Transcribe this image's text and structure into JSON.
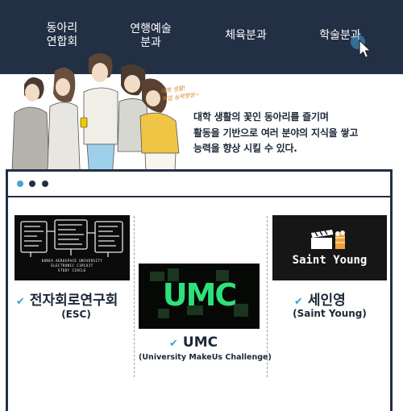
{
  "nav": {
    "items": [
      {
        "line1": "동아리",
        "line2": "연합회"
      },
      {
        "line1": "연행예술",
        "line2": "분과"
      },
      {
        "line1": "체육분과",
        "line2": ""
      },
      {
        "line1": "학술분과",
        "line2": ""
      }
    ]
  },
  "hero": {
    "handwriting_line1": "대학 생활!",
    "handwriting_line2": "학업 능력향상~",
    "text_lines": [
      "대학 생활의 꽃인 동아리를 즐기며",
      "활동을 기반으로 여러 분야의 지식을 쌓고",
      "능력을 향상 시킬 수 있다."
    ]
  },
  "clubs": [
    {
      "name": "전자회로연구회",
      "sub": "(ESC)",
      "caption1": "KOREA AEROSPACE UNIVERSITY",
      "caption2": "ELECTRONIC CIRCUIT",
      "caption3": "STUDY CIRCLE"
    },
    {
      "name": "UMC",
      "sub": "(University MakeUs Challenge)",
      "logo": "UMC"
    },
    {
      "name": "세인영",
      "sub": "(Saint Young)",
      "logo": "Saint Young"
    }
  ],
  "colors": {
    "nav_bg": "#232f45",
    "accent": "#3ea2d0",
    "umc_green": "#2fe07a"
  }
}
